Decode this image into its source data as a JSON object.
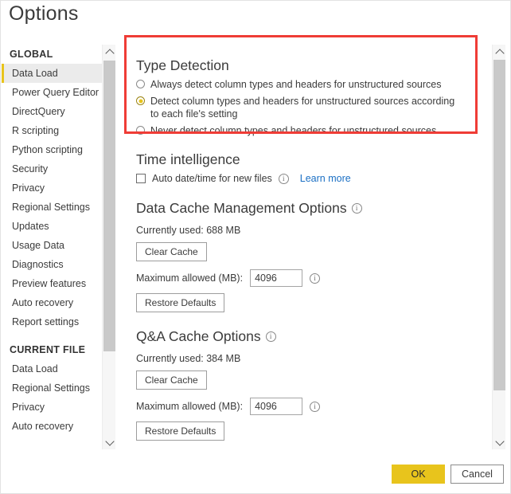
{
  "window": {
    "title": "Options"
  },
  "sidebar": {
    "groups": [
      {
        "label": "GLOBAL",
        "items": [
          {
            "label": "Data Load",
            "selected": true
          },
          {
            "label": "Power Query Editor",
            "selected": false
          },
          {
            "label": "DirectQuery",
            "selected": false
          },
          {
            "label": "R scripting",
            "selected": false
          },
          {
            "label": "Python scripting",
            "selected": false
          },
          {
            "label": "Security",
            "selected": false
          },
          {
            "label": "Privacy",
            "selected": false
          },
          {
            "label": "Regional Settings",
            "selected": false
          },
          {
            "label": "Updates",
            "selected": false
          },
          {
            "label": "Usage Data",
            "selected": false
          },
          {
            "label": "Diagnostics",
            "selected": false
          },
          {
            "label": "Preview features",
            "selected": false
          },
          {
            "label": "Auto recovery",
            "selected": false
          },
          {
            "label": "Report settings",
            "selected": false
          }
        ]
      },
      {
        "label": "CURRENT FILE",
        "items": [
          {
            "label": "Data Load",
            "selected": false
          },
          {
            "label": "Regional Settings",
            "selected": false
          },
          {
            "label": "Privacy",
            "selected": false
          },
          {
            "label": "Auto recovery",
            "selected": false
          }
        ]
      }
    ]
  },
  "type_detection": {
    "heading": "Type Detection",
    "options": [
      {
        "label": "Always detect column types and headers for unstructured sources",
        "selected": false
      },
      {
        "label": "Detect column types and headers for unstructured sources according to each file's setting",
        "selected": true
      },
      {
        "label": "Never detect column types and headers for unstructured sources",
        "selected": false
      }
    ]
  },
  "time_intelligence": {
    "heading": "Time intelligence",
    "checkbox_label": "Auto date/time for new files",
    "checkbox_checked": false,
    "info_icon": "info-icon",
    "learn_more": "Learn more"
  },
  "data_cache": {
    "heading": "Data Cache Management Options",
    "info_icon": "info-icon",
    "currently_used": "Currently used: 688 MB",
    "clear_cache_label": "Clear Cache",
    "max_allowed_label": "Maximum allowed (MB):",
    "max_allowed_value": "4096",
    "restore_defaults_label": "Restore Defaults"
  },
  "qna_cache": {
    "heading": "Q&A Cache Options",
    "info_icon": "info-icon",
    "currently_used": "Currently used: 384 MB",
    "clear_cache_label": "Clear Cache",
    "max_allowed_label": "Maximum allowed (MB):",
    "max_allowed_value": "4096",
    "restore_defaults_label": "Restore Defaults"
  },
  "footer": {
    "ok_label": "OK",
    "cancel_label": "Cancel"
  },
  "colors": {
    "accent_gold": "#e8c41c",
    "highlight_red": "#ef3c36",
    "link_blue": "#1a6fc4",
    "selected_bg": "#ebebeb"
  }
}
